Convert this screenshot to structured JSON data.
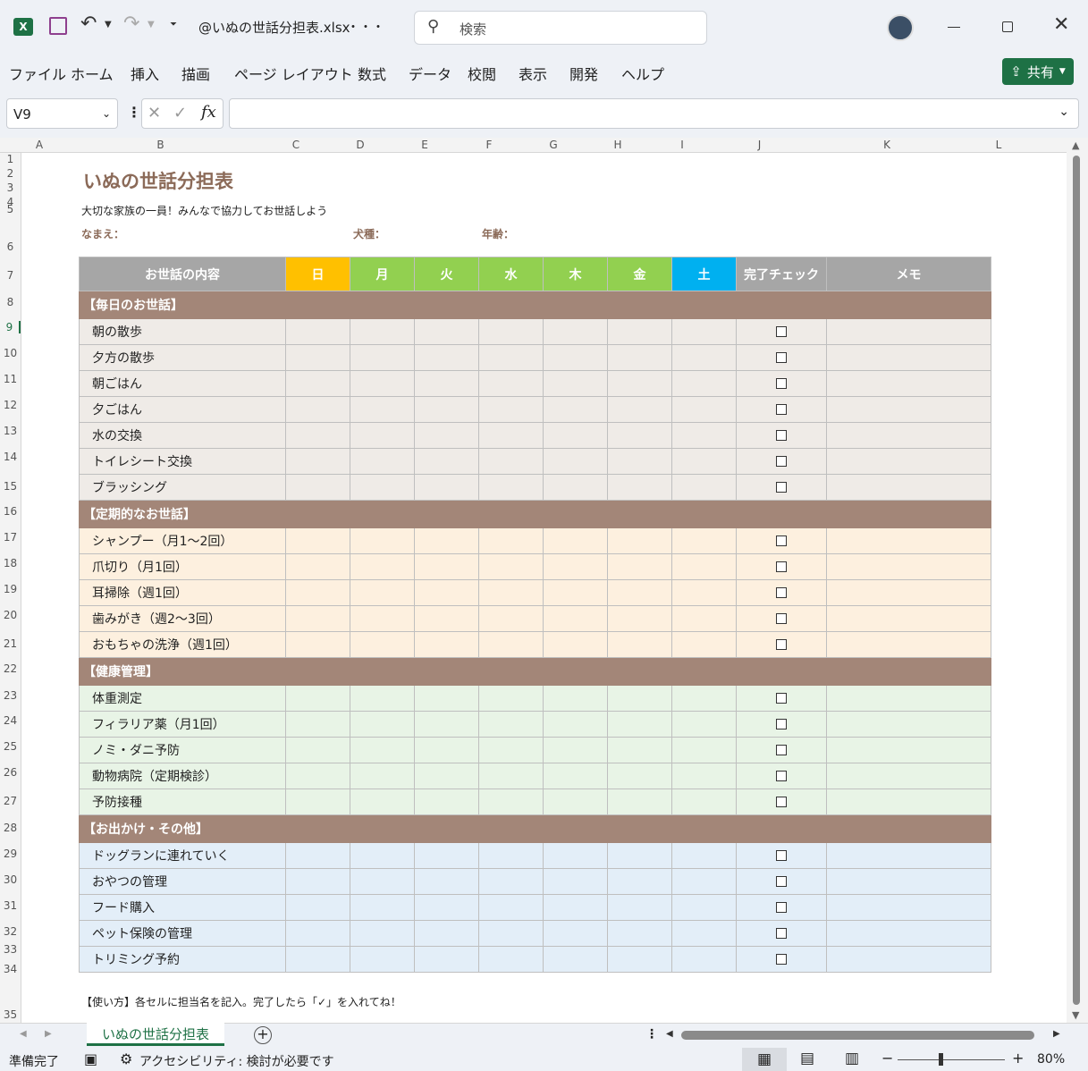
{
  "titlebar": {
    "filename": "@いぬの世話分担表.xlsx",
    "more": "・・・",
    "search_placeholder": "検索"
  },
  "menu": [
    "ファイル",
    "ホーム",
    "挿入",
    "描画",
    "ページ レイアウト",
    "数式",
    "データ",
    "校閲",
    "表示",
    "開発",
    "ヘルプ"
  ],
  "share_label": "共有",
  "namebox": "V9",
  "columns": [
    "A",
    "B",
    "C",
    "D",
    "E",
    "F",
    "G",
    "H",
    "I",
    "J",
    "K",
    "L"
  ],
  "rows": [
    "1",
    "2",
    "3",
    "4",
    "5",
    "6",
    "7",
    "8",
    "9",
    "10",
    "11",
    "12",
    "13",
    "14",
    "15",
    "16",
    "17",
    "18",
    "19",
    "20",
    "21",
    "22",
    "23",
    "24",
    "25",
    "26",
    "27",
    "28",
    "29",
    "30",
    "31",
    "32",
    "33",
    "34",
    "35"
  ],
  "sheet": {
    "title": "いぬの世話分担表",
    "subtitle": "大切な家族の一員！みんなで協力してお世話しよう",
    "name_label": "なまえ：",
    "breed_label": "犬種：",
    "age_label": "年齢：",
    "headers": {
      "task": "お世話の内容",
      "days": [
        "日",
        "月",
        "火",
        "水",
        "木",
        "金",
        "土"
      ],
      "check": "完了チェック",
      "memo": "メモ"
    },
    "sections": [
      {
        "title": "【毎日のお世話】",
        "bg": "#efebe7",
        "items": [
          "朝の散歩",
          "夕方の散歩",
          "朝ごはん",
          "夕ごはん",
          "水の交換",
          "トイレシート交換",
          "ブラッシング"
        ]
      },
      {
        "title": "【定期的なお世話】",
        "bg": "#fdf0df",
        "items": [
          "シャンプー（月1〜2回）",
          "爪切り（月1回）",
          "耳掃除（週1回）",
          "歯みがき（週2〜3回）",
          "おもちゃの洗浄（週1回）"
        ]
      },
      {
        "title": "【健康管理】",
        "bg": "#e8f4e6",
        "items": [
          "体重測定",
          "フィラリア薬（月1回）",
          "ノミ・ダニ予防",
          "動物病院（定期検診）",
          "予防接種"
        ]
      },
      {
        "title": "【お出かけ・その他】",
        "bg": "#e3eef8",
        "items": [
          "ドッグランに連れていく",
          "おやつの管理",
          "フード購入",
          "ペット保険の管理",
          "トリミング予約"
        ]
      }
    ],
    "footer": "【使い方】各セルに担当名を記入。完了したら「✓」を入れてね！"
  },
  "colors": {
    "title": "#8b6a58",
    "header": "#a6a6a6",
    "sun": "#ffc000",
    "weekday": "#92d050",
    "sat": "#00b0f0",
    "category": "#a38678",
    "excel_green": "#1e7145"
  },
  "tab": {
    "name": "いぬの世話分担表"
  },
  "status": {
    "ready": "準備完了",
    "accessibility": "アクセシビリティ: 検討が必要です",
    "zoom": "80%"
  }
}
